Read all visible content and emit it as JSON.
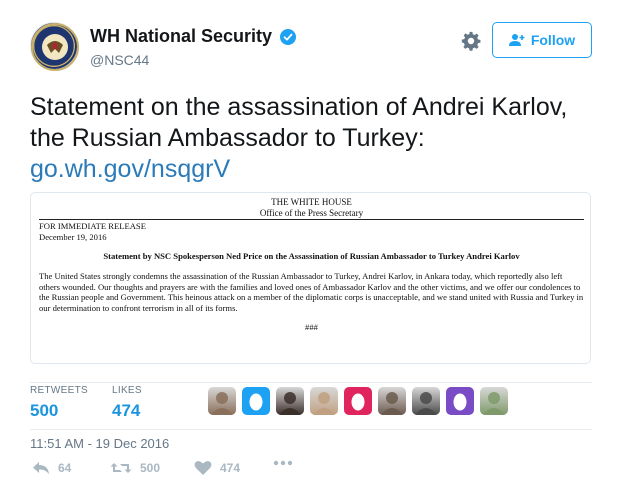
{
  "header": {
    "display_name": "WH National Security",
    "handle": "@NSC44",
    "follow_label": "Follow"
  },
  "tweet": {
    "text": "Statement on the assassination of Andrei Karlov, the Russian Ambassador to Turkey:",
    "link": "go.wh.gov/nsqgrV"
  },
  "document": {
    "house": "THE WHITE HOUSE",
    "office": "Office of the Press Secretary",
    "release": "FOR IMMEDIATE RELEASE",
    "date": "December 19, 2016",
    "heading": "Statement by NSC Spokesperson Ned Price on the Assassination of Russian Ambassador to Turkey Andrei Karlov",
    "body": "The United States strongly condemns the assassination of the Russian Ambassador to Turkey, Andrei Karlov, in Ankara today, which reportedly also left others wounded. Our thoughts and prayers are with the families and loved ones of Ambassador Karlov and the other victims, and we offer our condolences to the Russian people and Government. This heinous attack on a member of the diplomatic corps is unacceptable, and we stand united with Russia and Turkey in our determination to confront terrorism in all of its forms.",
    "end_mark": "###"
  },
  "stats": {
    "retweets_label": "RETWEETS",
    "retweets_value": "500",
    "likes_label": "LIKES",
    "likes_value": "474"
  },
  "likers": [
    {
      "kind": "photo",
      "color": "#8a6f5a"
    },
    {
      "kind": "egg",
      "color": "#1da1f2"
    },
    {
      "kind": "photo",
      "color": "#3b2f2a"
    },
    {
      "kind": "photo",
      "color": "#c0a080"
    },
    {
      "kind": "egg",
      "color": "#e0245e"
    },
    {
      "kind": "photo",
      "color": "#6b5a4e"
    },
    {
      "kind": "photo",
      "color": "#4a4a4a"
    },
    {
      "kind": "egg",
      "color": "#794bc4"
    },
    {
      "kind": "photo",
      "color": "#7f9a6a"
    }
  ],
  "timestamp": "11:51 AM - 19 Dec 2016",
  "actions": {
    "reply_count": "64",
    "retweet_count": "500",
    "like_count": "474"
  },
  "colors": {
    "accent": "#1da1f2",
    "link": "#2b7bb9",
    "muted": "#657786"
  },
  "icons": [
    "presidential-seal-avatar",
    "verified-badge-icon",
    "gear-icon",
    "add-user-icon",
    "reply-icon",
    "retweet-icon",
    "heart-icon",
    "more-icon"
  ]
}
